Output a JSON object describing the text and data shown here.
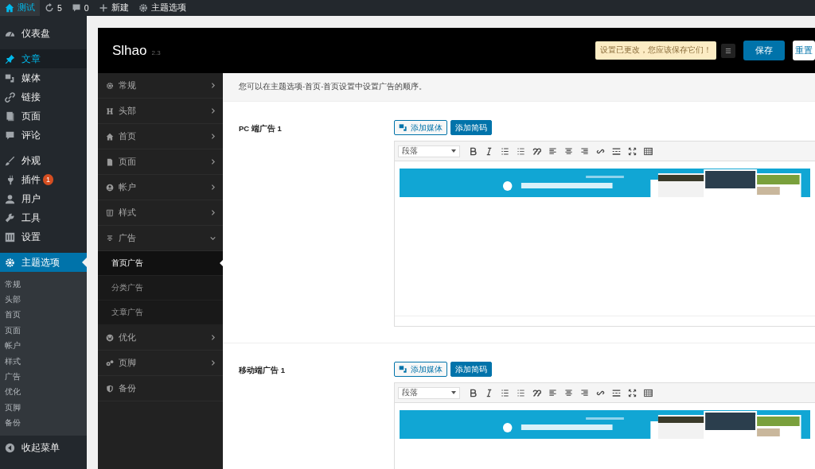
{
  "admin_bar": {
    "items": [
      {
        "label": "测试",
        "selected": true
      },
      {
        "label": "5",
        "selected": false
      },
      {
        "label": "0",
        "selected": false
      },
      {
        "label": "新建",
        "selected": false
      },
      {
        "label": "主题选项",
        "selected": false
      }
    ]
  },
  "wp_menu": {
    "items": [
      {
        "kind": "item",
        "label": "仪表盘",
        "highlighted": false,
        "selected": false
      },
      {
        "kind": "separator"
      },
      {
        "kind": "item",
        "label": "文章",
        "highlighted": true,
        "selected": false
      },
      {
        "kind": "item",
        "label": "媒体",
        "highlighted": false,
        "selected": false
      },
      {
        "kind": "item",
        "label": "链接",
        "highlighted": false,
        "selected": false
      },
      {
        "kind": "item",
        "label": "页面",
        "highlighted": false,
        "selected": false
      },
      {
        "kind": "item",
        "label": "评论",
        "highlighted": false,
        "selected": false
      },
      {
        "kind": "separator"
      },
      {
        "kind": "item",
        "label": "外观",
        "highlighted": false,
        "selected": false
      },
      {
        "kind": "item",
        "label": "插件",
        "highlighted": false,
        "selected": false,
        "badge": "1"
      },
      {
        "kind": "item",
        "label": "用户",
        "highlighted": false,
        "selected": false
      },
      {
        "kind": "item",
        "label": "工具",
        "highlighted": false,
        "selected": false
      },
      {
        "kind": "item",
        "label": "设置",
        "highlighted": false,
        "selected": false
      },
      {
        "kind": "separator"
      },
      {
        "kind": "item",
        "label": "主题选项",
        "highlighted": false,
        "selected": true,
        "children": [
          "常规",
          "头部",
          "首页",
          "页面",
          "帐户",
          "样式",
          "广告",
          "优化",
          "页脚",
          "备份"
        ]
      }
    ],
    "collapse": "收起菜单"
  },
  "panel": {
    "title": "Slhao",
    "version": "2.3",
    "notice": "设置已更改，您应该保存它们！",
    "buttons": [
      {
        "label": "保存",
        "kind": "primary"
      },
      {
        "label": "重置",
        "kind": "secondary"
      }
    ],
    "nav": [
      {
        "label": "常规",
        "kind": "group",
        "expanded": false
      },
      {
        "label": "头部",
        "kind": "group",
        "expanded": false
      },
      {
        "label": "首页",
        "kind": "group",
        "expanded": false
      },
      {
        "label": "页面",
        "kind": "group",
        "expanded": false
      },
      {
        "label": "帐户",
        "kind": "group",
        "expanded": false
      },
      {
        "label": "样式",
        "kind": "group",
        "expanded": false
      },
      {
        "label": "广告",
        "kind": "group",
        "expanded": true,
        "children": [
          {
            "label": "首页广告",
            "selected": true
          },
          {
            "label": "分类广告",
            "selected": false
          },
          {
            "label": "文章广告",
            "selected": false
          }
        ]
      },
      {
        "label": "优化",
        "kind": "group",
        "expanded": false
      },
      {
        "label": "页脚",
        "kind": "group",
        "expanded": false
      },
      {
        "label": "备份",
        "kind": "single"
      }
    ],
    "intro": "您可以在主题选项-首页-首页设置中设置广告的顺序。",
    "sections": [
      {
        "label": "PC 端广告 1",
        "media_button": "添加媒体",
        "code_button": "添加简码",
        "format": "段落"
      },
      {
        "label": "移动端广告 1",
        "media_button": "添加媒体",
        "code_button": "添加简码",
        "format": "段落"
      }
    ]
  }
}
